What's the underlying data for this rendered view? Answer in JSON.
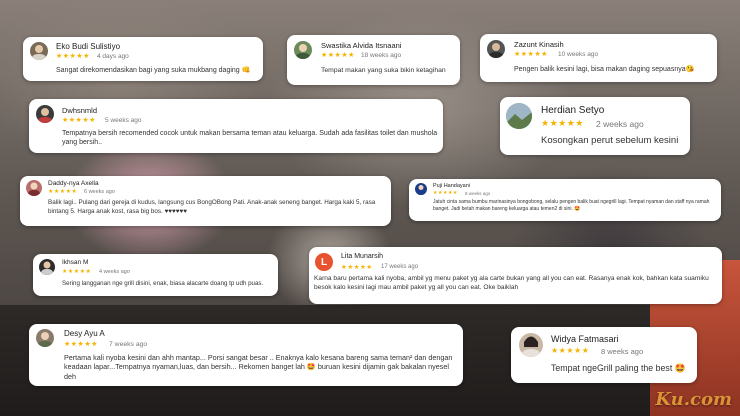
{
  "stars_glyph": "★★★★★",
  "colors": {
    "star": "#f5b301",
    "lita_avatar": "#e8532f"
  },
  "reviews": [
    {
      "name": "Eko Budi Sulistiyo",
      "time": "4 days ago",
      "text": "Sangat direkomendasikan bagi yang suka mukbang daging 👊"
    },
    {
      "name": "Swastika Alvida Itsnaani",
      "time": "18 weeks ago",
      "text": "Tempat makan yang suka bikin ketagihan"
    },
    {
      "name": "Zazunt Kinasih",
      "time": "10 weeks ago",
      "text": "Pengen balik kesini lagi, bisa makan daging sepuasnya😘"
    },
    {
      "name": "Dwhsnmld",
      "time": "5 weeks ago",
      "text": "Tempatnya bersih recomended cocok untuk makan bersama teman atau keluarga. Sudah ada fasilitas toilet dan mushola yang bersih.."
    },
    {
      "name": "Herdian Setyo",
      "time": "2 weeks ago",
      "text": "Kosongkan perut sebelum kesini"
    },
    {
      "name": "Daddy-nya Axella",
      "time": "6 weeks ago",
      "text": "Balik lagi.. Pulang dari gereja di kudus, langsung cus BongOBong Pati. Anak-anak seneng banget. Harga kaki 5, rasa bintang 5. Harga anak kost, rasa big bos. ♥♥♥♥♥♥"
    },
    {
      "name": "Puji Handayani",
      "time": "8 weeks ago",
      "text": "Jatuh cinta sama bumbu marinasinya bongobong, selalu pengen balik buat ngegrill lagi. Tempat nyaman dan staff nya ramah banget. Jadi betah makan bareng keluarga atau temen2 di sini. 🤩"
    },
    {
      "name": "Ikhsan M",
      "time": "4 weeks ago",
      "text": "Sering langganan nge grill disini, enak, biasa alacarte doang tp udh puas."
    },
    {
      "name": "Lita Munarsih",
      "initial": "L",
      "time": "17 weeks ago",
      "text": "Karna baru pertama kali nyoba, ambil yg menu paket yg ala carte bukan yang all you can eat. Rasanya enak kok, bahkan kata suamiku besok kalo kesini lagi mau ambil paket yg all you can eat. Oke baiklah"
    },
    {
      "name": "Desy Ayu A",
      "time": "7 weeks ago",
      "text": "Pertama kali nyoba kesini dan ahh mantap... Porsi sangat besar .. Enaknya kalo kesana bareng sama teman² dan dengan keadaan lapar...Tempatnya nyaman,luas, dan bersih... Rekomen banget lah 🤩 buruan kesini dijamin gak bakalan nyesel deh"
    },
    {
      "name": "Widya Fatmasari",
      "time": "8 weeks ago",
      "text": "Tempat ngeGrill paling the best 🤩"
    }
  ],
  "watermark": "Ku.com"
}
